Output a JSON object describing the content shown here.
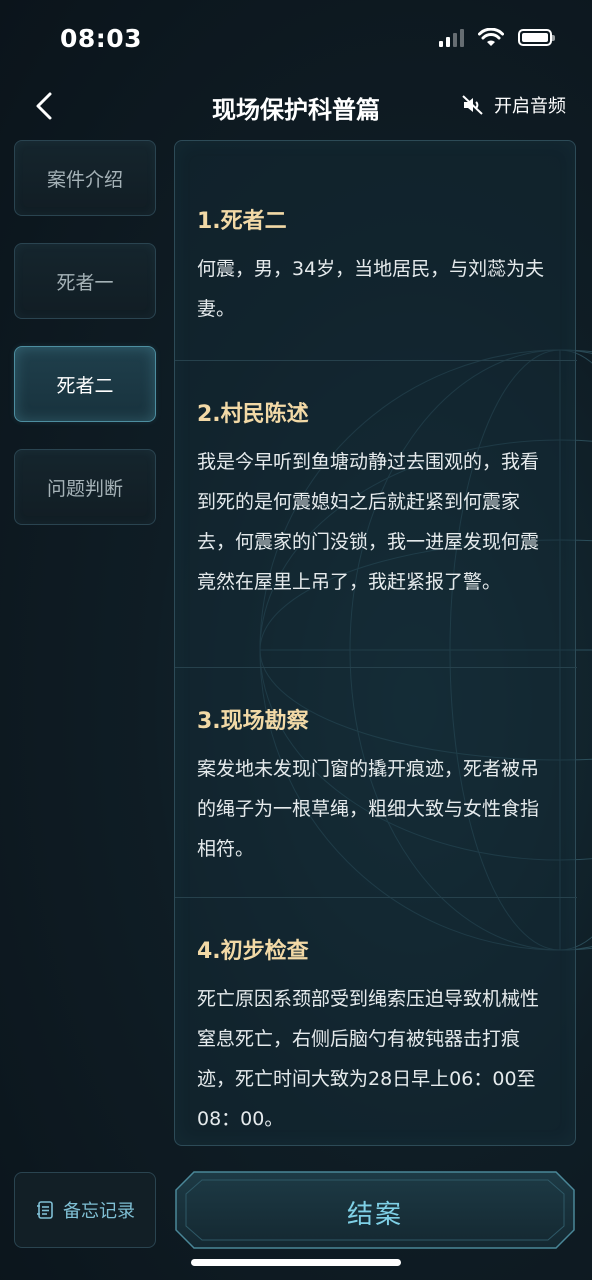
{
  "status_bar": {
    "time": "08:03"
  },
  "header": {
    "title": "现场保护科普篇",
    "audio_label": "开启音频"
  },
  "sidebar": {
    "items": [
      {
        "label": "案件介绍",
        "active": false
      },
      {
        "label": "死者一",
        "active": false
      },
      {
        "label": "死者二",
        "active": true
      },
      {
        "label": "问题判断",
        "active": false
      }
    ]
  },
  "sections": [
    {
      "title": "1.死者二",
      "body": "何震，男，34岁，当地居民，与刘蕊为夫妻。"
    },
    {
      "title": "2.村民陈述",
      "body": "我是今早听到鱼塘动静过去围观的，我看到死的是何震媳妇之后就赶紧到何震家去，何震家的门没锁，我一进屋发现何震竟然在屋里上吊了，我赶紧报了警。"
    },
    {
      "title": "3.现场勘察",
      "body": "案发地未发现门窗的撬开痕迹，死者被吊的绳子为一根草绳，粗细大致与女性食指相符。"
    },
    {
      "title": "4.初步检查",
      "body": "死亡原因系颈部受到绳索压迫导致机械性窒息死亡，右侧后脑勺有被钝器击打痕迹，死亡时间大致为28日早上06：00至08：00。"
    }
  ],
  "footer": {
    "memo_label": "备忘记录",
    "close_case_label": "结案"
  },
  "colors": {
    "accent": "#7fd0e6",
    "section_title": "#f2d9a6",
    "background": "#0f1d25"
  }
}
